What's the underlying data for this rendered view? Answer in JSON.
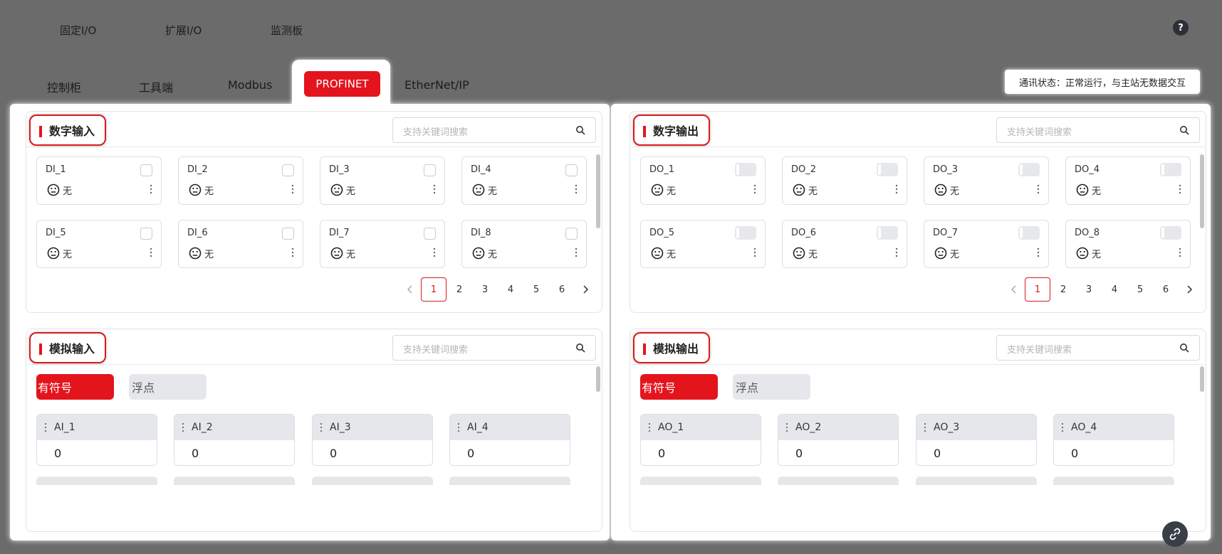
{
  "top_tabs": [
    "固定I/O",
    "扩展I/O",
    "监测板"
  ],
  "help": {
    "label": "?"
  },
  "sub_tabs": {
    "control_cabinet": "控制柜",
    "tool_end": "工具端",
    "modbus": "Modbus",
    "profinet": "PROFINET",
    "ethernet_ip": "EtherNet/IP"
  },
  "comm_status": "通讯状态：正常运行，与主站无数据交互",
  "search_placeholder": "支持关键词搜索",
  "digital_input": {
    "title": "数字输入",
    "items": [
      {
        "name": "DI_1",
        "status": "无"
      },
      {
        "name": "DI_2",
        "status": "无"
      },
      {
        "name": "DI_3",
        "status": "无"
      },
      {
        "name": "DI_4",
        "status": "无"
      },
      {
        "name": "DI_5",
        "status": "无"
      },
      {
        "name": "DI_6",
        "status": "无"
      },
      {
        "name": "DI_7",
        "status": "无"
      },
      {
        "name": "DI_8",
        "status": "无"
      }
    ],
    "pages": [
      "1",
      "2",
      "3",
      "4",
      "5",
      "6"
    ],
    "current_page": "1"
  },
  "digital_output": {
    "title": "数字输出",
    "items": [
      {
        "name": "DO_1",
        "status": "无"
      },
      {
        "name": "DO_2",
        "status": "无"
      },
      {
        "name": "DO_3",
        "status": "无"
      },
      {
        "name": "DO_4",
        "status": "无"
      },
      {
        "name": "DO_5",
        "status": "无"
      },
      {
        "name": "DO_6",
        "status": "无"
      },
      {
        "name": "DO_7",
        "status": "无"
      },
      {
        "name": "DO_8",
        "status": "无"
      }
    ],
    "pages": [
      "1",
      "2",
      "3",
      "4",
      "5",
      "6"
    ],
    "current_page": "1"
  },
  "analog_input": {
    "title": "模拟输入",
    "type_signed": "有符号",
    "type_float": "浮点",
    "items": [
      {
        "name": "AI_1",
        "value": "0"
      },
      {
        "name": "AI_2",
        "value": "0"
      },
      {
        "name": "AI_3",
        "value": "0"
      },
      {
        "name": "AI_4",
        "value": "0"
      }
    ]
  },
  "analog_output": {
    "title": "模拟输出",
    "type_signed": "有符号",
    "type_float": "浮点",
    "items": [
      {
        "name": "AO_1",
        "value": "0"
      },
      {
        "name": "AO_2",
        "value": "0"
      },
      {
        "name": "AO_3",
        "value": "0"
      },
      {
        "name": "AO_4",
        "value": "0"
      }
    ]
  },
  "colors": {
    "accent": "#e4141d",
    "background": "#6b6b6b"
  },
  "icons": [
    "help-icon",
    "search-icon",
    "face-neutral-icon",
    "kebab-menu-icon",
    "drag-handle-icon",
    "link-icon",
    "chevron-left-icon",
    "chevron-right-icon"
  ]
}
